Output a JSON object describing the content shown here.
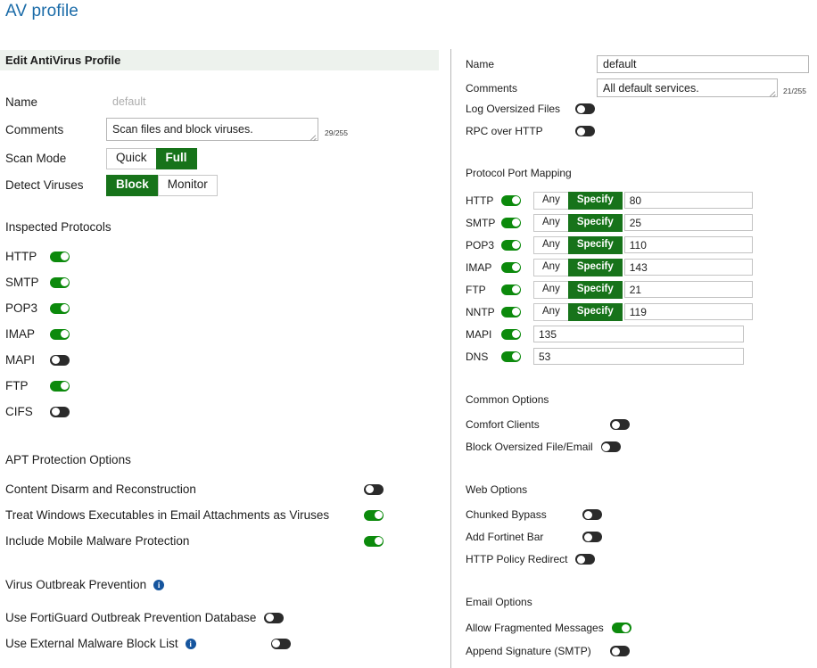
{
  "page": {
    "title": "AV profile"
  },
  "left": {
    "header": "Edit AntiVirus Profile",
    "fields": {
      "name_label": "Name",
      "name_value": "default",
      "comments_label": "Comments",
      "comments_value": "Scan files and block viruses.",
      "comments_counter": "29/255",
      "scan_mode_label": "Scan Mode",
      "scan_mode_options": [
        "Quick",
        "Full"
      ],
      "scan_mode_selected": "Full",
      "detect_viruses_label": "Detect Viruses",
      "detect_viruses_options": [
        "Block",
        "Monitor"
      ],
      "detect_viruses_selected": "Block"
    },
    "inspected_protocols": {
      "title": "Inspected Protocols",
      "items": [
        {
          "label": "HTTP",
          "on": true
        },
        {
          "label": "SMTP",
          "on": true
        },
        {
          "label": "POP3",
          "on": true
        },
        {
          "label": "IMAP",
          "on": true
        },
        {
          "label": "MAPI",
          "on": false
        },
        {
          "label": "FTP",
          "on": true
        },
        {
          "label": "CIFS",
          "on": false
        }
      ]
    },
    "apt_protection": {
      "title": "APT Protection Options",
      "items": [
        {
          "label": "Content Disarm and Reconstruction",
          "on": false
        },
        {
          "label": "Treat Windows Executables in Email Attachments as Viruses",
          "on": true
        },
        {
          "label": "Include Mobile Malware Protection",
          "on": true
        }
      ]
    },
    "virus_outbreak": {
      "title": "Virus Outbreak Prevention",
      "title_has_info": true,
      "items": [
        {
          "label": "Use FortiGuard Outbreak Prevention Database",
          "on": false,
          "info": false
        },
        {
          "label": "Use External Malware Block List",
          "on": false,
          "info": true
        }
      ]
    }
  },
  "right": {
    "fields": {
      "name_label": "Name",
      "name_value": "default",
      "comments_label": "Comments",
      "comments_value": "All default services.",
      "comments_counter": "21/255",
      "log_oversized_label": "Log Oversized Files",
      "log_oversized_on": false,
      "rpc_over_http_label": "RPC over HTTP",
      "rpc_over_http_on": false
    },
    "protocol_port_mapping": {
      "title": "Protocol Port Mapping",
      "seg_options": [
        "Any",
        "Specify"
      ],
      "rows": [
        {
          "label": "HTTP",
          "on": true,
          "mode": "Specify",
          "port": "80",
          "has_segment": true
        },
        {
          "label": "SMTP",
          "on": true,
          "mode": "Specify",
          "port": "25",
          "has_segment": true
        },
        {
          "label": "POP3",
          "on": true,
          "mode": "Specify",
          "port": "110",
          "has_segment": true
        },
        {
          "label": "IMAP",
          "on": true,
          "mode": "Specify",
          "port": "143",
          "has_segment": true
        },
        {
          "label": "FTP",
          "on": true,
          "mode": "Specify",
          "port": "21",
          "has_segment": true
        },
        {
          "label": "NNTP",
          "on": true,
          "mode": "Specify",
          "port": "119",
          "has_segment": true
        },
        {
          "label": "MAPI",
          "on": true,
          "mode": "",
          "port": "135",
          "has_segment": false
        },
        {
          "label": "DNS",
          "on": true,
          "mode": "",
          "port": "53",
          "has_segment": false
        }
      ]
    },
    "common_options": {
      "title": "Common Options",
      "items": [
        {
          "label": "Comfort Clients",
          "on": false
        },
        {
          "label": "Block Oversized File/Email",
          "on": false
        }
      ]
    },
    "web_options": {
      "title": "Web Options",
      "items": [
        {
          "label": "Chunked Bypass",
          "on": false
        },
        {
          "label": "Add Fortinet Bar",
          "on": false
        },
        {
          "label": "HTTP Policy Redirect",
          "on": false
        }
      ]
    },
    "email_options": {
      "title": "Email Options",
      "items": [
        {
          "label": "Allow Fragmented Messages",
          "on": true
        },
        {
          "label": "Append Signature (SMTP)",
          "on": false
        }
      ]
    }
  },
  "colors": {
    "title_blue": "#1a6ba8",
    "toggle_on": "#0c8a0c",
    "toggle_off": "#2b2b2b",
    "segment_active": "#17731a",
    "header_band": "#edf2ed",
    "info_blue": "#15559e"
  }
}
